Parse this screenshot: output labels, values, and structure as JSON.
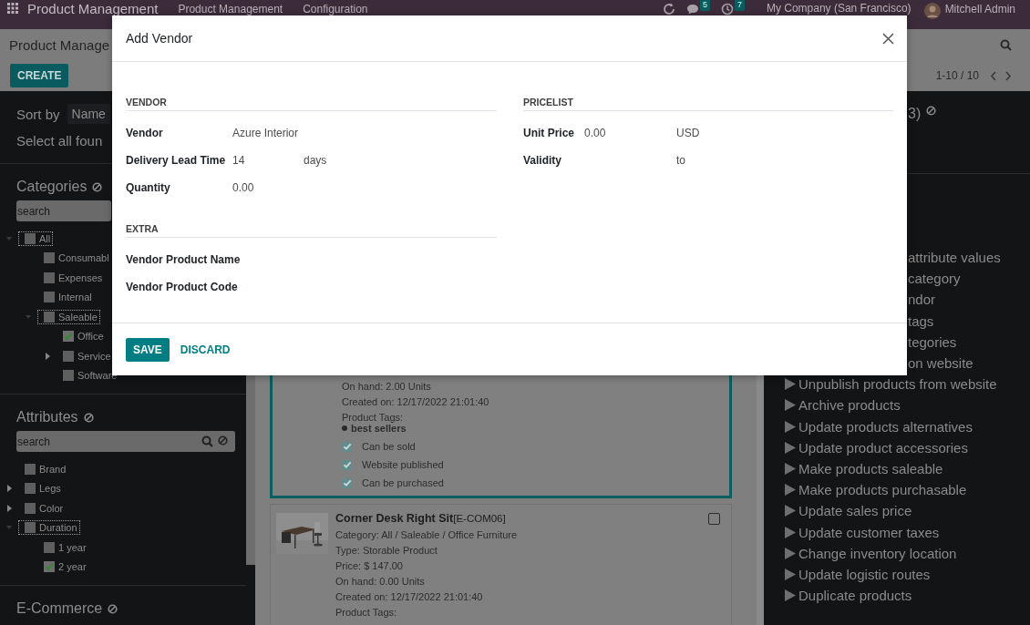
{
  "navbar": {
    "app_title": "Product Management",
    "menu": [
      "Product Management",
      "Configuration"
    ],
    "messages_badge": "5",
    "activities_badge": "7",
    "company": "My Company (San Francisco)",
    "user": "Mitchell Admin"
  },
  "control_panel": {
    "breadcrumb": "Product Manage",
    "create_button": "CREATE",
    "pager": "1-10 / 10"
  },
  "sidebar": {
    "sort_label": "Sort by",
    "sort_value": "Name",
    "select_all": "Select all foun",
    "sections": [
      {
        "title": "Categories",
        "search_placeholder": "search",
        "search_icons": false,
        "items": [
          {
            "label": "All",
            "checked": false,
            "selected": true,
            "expandable": true,
            "expanded": true,
            "children": [
              {
                "label": "Consumabl",
                "checked": false,
                "selected": false,
                "expandable": false
              },
              {
                "label": "Expenses",
                "checked": false,
                "selected": false,
                "expandable": false
              },
              {
                "label": "Internal",
                "checked": false,
                "selected": false,
                "expandable": false
              },
              {
                "label": "Saleable",
                "checked": false,
                "selected": true,
                "expandable": true,
                "expanded": true,
                "children": [
                  {
                    "label": "Office",
                    "checked": true,
                    "selected": false,
                    "expandable": false
                  },
                  {
                    "label": "Service",
                    "checked": false,
                    "selected": false,
                    "expandable": true,
                    "expanded": false
                  },
                  {
                    "label": "Software",
                    "checked": false,
                    "selected": false,
                    "expandable": false
                  }
                ]
              }
            ]
          }
        ]
      },
      {
        "title": "Attributes",
        "search_placeholder": "search",
        "search_icons": true,
        "items": [
          {
            "label": "Brand",
            "checked": false,
            "selected": false,
            "expandable": false
          },
          {
            "label": "Legs",
            "checked": false,
            "selected": false,
            "expandable": true,
            "expanded": false
          },
          {
            "label": "Color",
            "checked": false,
            "selected": false,
            "expandable": true,
            "expanded": false
          },
          {
            "label": "Duration",
            "checked": false,
            "selected": true,
            "expandable": true,
            "expanded": true,
            "children": [
              {
                "label": "1 year",
                "checked": false,
                "selected": false,
                "expandable": false
              },
              {
                "label": "2 year",
                "checked": true,
                "selected": false,
                "expandable": false
              }
            ]
          }
        ]
      },
      {
        "title": "E-Commerce"
      }
    ]
  },
  "cards": [
    {
      "selected": true,
      "lines": [
        "On hand: 2.00 Units",
        "Created on: 12/17/2022 21:01:40"
      ],
      "tags_label": "Product Tags:",
      "tags": [
        "best sellers"
      ],
      "flags": [
        {
          "label": "Can be sold",
          "checked": true
        },
        {
          "label": "Website published",
          "checked": true
        },
        {
          "label": "Can be purchased",
          "checked": true
        }
      ]
    },
    {
      "selected": false,
      "checked": false,
      "picture": {
        "kind": "picture"
      },
      "name": "Corner Desk Right Sit",
      "code": "[E-COM06]",
      "lines": [
        "Category: All / Saleable / Office Furniture",
        "Type: Storable Product",
        "Price: $ 147.00",
        "On hand: 0.00 Units",
        "Created on: 12/17/2022 21:01:40"
      ],
      "tags_label": "Product Tags:"
    }
  ],
  "actions_panel": {
    "header_fragment": "3)",
    "partial_actions": [
      "attribute values",
      "category",
      "ndor",
      "tags",
      "tegories",
      "on website"
    ],
    "actions": [
      "Unpublish products from website",
      "Archive products",
      "Update products alternatives",
      "Update product accessories",
      "Make products saleable",
      "Make products purchasable",
      "Update sales price",
      "Update customer taxes",
      "Change inventory location",
      "Update logistic routes",
      "Duplicate products"
    ]
  },
  "dialog": {
    "title": "Add Vendor",
    "left_sections": [
      {
        "heading": "VENDOR",
        "fields": [
          {
            "label": "Vendor",
            "value": "Azure Interior"
          },
          {
            "label": "Delivery Lead Time",
            "value": "14",
            "unit": "days"
          },
          {
            "label": "Quantity",
            "value": "0.00"
          }
        ]
      },
      {
        "heading": "EXTRA",
        "fields": [
          {
            "label": "Vendor Product Name"
          },
          {
            "label": "Vendor Product Code"
          }
        ]
      }
    ],
    "right_sections": [
      {
        "heading": "PRICELIST",
        "fields": [
          {
            "label": "Unit Price",
            "value": "0.00",
            "unit": "USD"
          },
          {
            "label": "Validity",
            "kind": "range",
            "separator": "to"
          }
        ]
      }
    ],
    "save_button": "SAVE",
    "discard_button": "DISCARD"
  }
}
